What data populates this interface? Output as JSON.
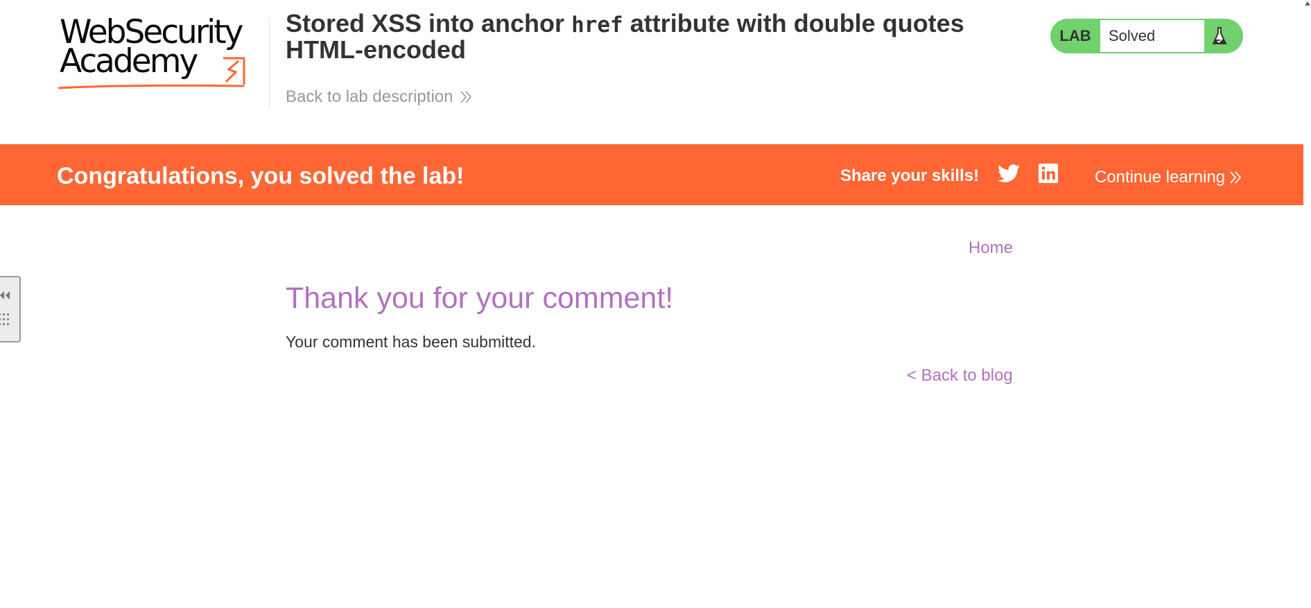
{
  "logo": {
    "line1": "WebSecurity",
    "line2": "Academy"
  },
  "lab": {
    "title_before": "Stored XSS into anchor",
    "title_code": "href",
    "title_after": "attribute with double quotes HTML-encoded",
    "back_link": "Back to lab description",
    "status_label": "LAB",
    "status_value": "Solved",
    "status_color": "#70d16d"
  },
  "banner": {
    "message": "Congratulations, you solved the lab!",
    "share_label": "Share your skills!",
    "continue_label": "Continue learning",
    "background_color": "#ff6633",
    "icons": [
      "twitter-icon",
      "linkedin-icon"
    ]
  },
  "nav": {
    "home": "Home"
  },
  "main": {
    "heading": "Thank you for your comment!",
    "message": "Your comment has been submitted.",
    "back_link": "< Back to blog",
    "accent_color": "#b071c0"
  }
}
